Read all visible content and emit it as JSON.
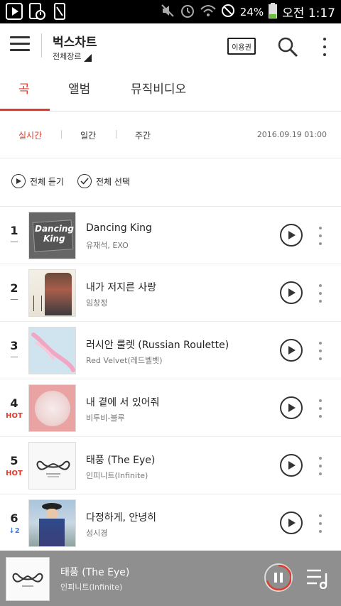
{
  "status_bar": {
    "battery": "24%",
    "time": "오전 1:17"
  },
  "app_bar": {
    "title": "벅스차트",
    "genre": "전체장르",
    "voucher_label": "이용권"
  },
  "tabs": [
    {
      "label": "곡"
    },
    {
      "label": "앨범"
    },
    {
      "label": "뮤직비디오"
    }
  ],
  "subtabs": [
    {
      "label": "실시간"
    },
    {
      "label": "일간"
    },
    {
      "label": "주간"
    }
  ],
  "datetime": "2016.09.19 01:00",
  "actions": {
    "play_all": "전체 듣기",
    "select_all": "전체 선택"
  },
  "chart": [
    {
      "rank": "1",
      "change": "",
      "change_type": "flat",
      "title": "Dancing King",
      "artist": "유재석, EXO"
    },
    {
      "rank": "2",
      "change": "",
      "change_type": "flat",
      "title": "내가 저지른 사랑",
      "artist": "임창정"
    },
    {
      "rank": "3",
      "change": "",
      "change_type": "flat",
      "title": "러시안 룰렛 (Russian Roulette)",
      "artist": "Red Velvet(레드벨벳)"
    },
    {
      "rank": "4",
      "change": "HOT",
      "change_type": "hot",
      "title": "내 곁에 서 있어줘",
      "artist": "비투비-블루"
    },
    {
      "rank": "5",
      "change": "HOT",
      "change_type": "hot",
      "title": "태풍 (The Eye)",
      "artist": "인피니트(Infinite)"
    },
    {
      "rank": "6",
      "change": "2",
      "change_type": "down",
      "title": "다정하게, 안녕히",
      "artist": "성시경"
    }
  ],
  "album_art": [
    {
      "text_1": "Dancing",
      "text_2": "King"
    }
  ],
  "now_playing": {
    "title": "태풍 (The Eye)",
    "artist": "인피니트(Infinite)"
  },
  "colors": {
    "accent": "#e03b2c",
    "down": "#3c7de0",
    "player_bg": "#8f8f8f"
  }
}
